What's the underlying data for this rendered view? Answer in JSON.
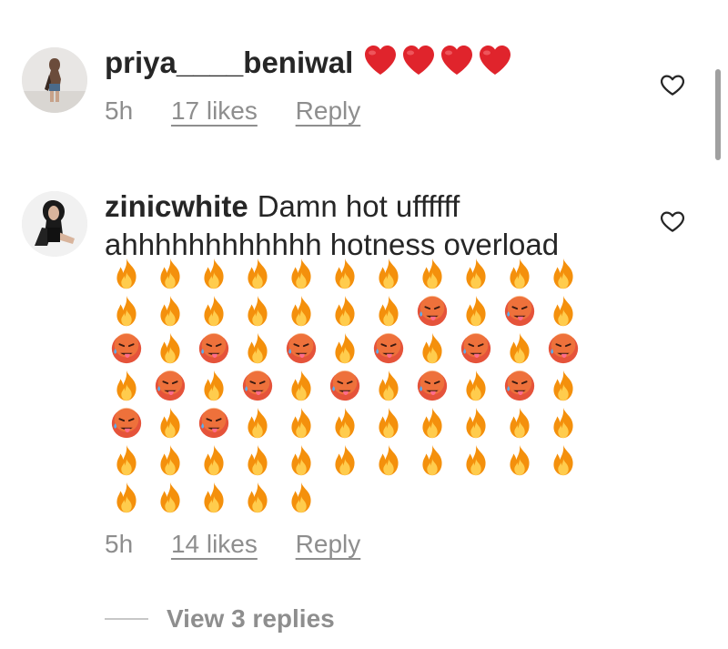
{
  "comments": [
    {
      "username": "priya____beniwal",
      "text": "",
      "inline_emoji": [
        "red-heart",
        "red-heart",
        "red-heart",
        "red-heart"
      ],
      "time": "5h",
      "likes": "17 likes",
      "reply": "Reply"
    },
    {
      "username": "zinicwhite",
      "text": "Damn hot uffffff ahhhhhhhhhhhh hotness overload",
      "emoji_grid": [
        "fire",
        "fire",
        "fire",
        "fire",
        "fire",
        "fire",
        "fire",
        "fire",
        "fire",
        "fire",
        "fire",
        "fire",
        "fire",
        "fire",
        "fire",
        "fire",
        "fire",
        "fire",
        "hot-face",
        "fire",
        "hot-face",
        "fire",
        "hot-face",
        "fire",
        "hot-face",
        "fire",
        "hot-face",
        "fire",
        "hot-face",
        "fire",
        "hot-face",
        "fire",
        "hot-face",
        "fire",
        "hot-face",
        "fire",
        "hot-face",
        "fire",
        "hot-face",
        "fire",
        "hot-face",
        "fire",
        "hot-face",
        "fire",
        "hot-face",
        "fire",
        "hot-face",
        "fire",
        "fire",
        "fire",
        "fire",
        "fire",
        "fire",
        "fire",
        "fire",
        "fire",
        "fire",
        "fire",
        "fire",
        "fire",
        "fire",
        "fire",
        "fire",
        "fire",
        "fire",
        "fire",
        "fire",
        "fire",
        "fire",
        "fire",
        "fire"
      ],
      "time": "5h",
      "likes": "14 likes",
      "reply": "Reply"
    }
  ],
  "view_replies": "View 3 replies",
  "colors": {
    "text": "#262626",
    "muted": "#8e8e8e",
    "fire": "#f4900c",
    "hot_face": "#e25822"
  }
}
